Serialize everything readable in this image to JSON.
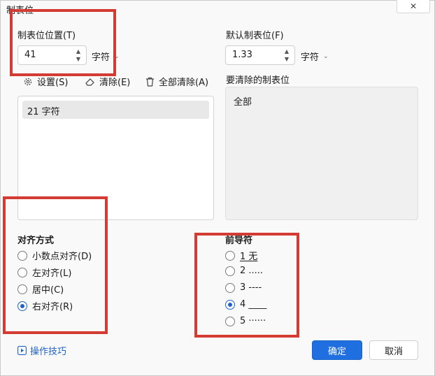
{
  "window": {
    "title": "制表位",
    "close_glyph": "✕"
  },
  "tab_position": {
    "label": "制表位位置(T)",
    "value": "41",
    "unit": "字符"
  },
  "default_tab": {
    "label": "默认制表位(F)",
    "value": "1.33",
    "unit": "字符"
  },
  "tabs_to_clear": {
    "label": "要清除的制表位",
    "value": "全部"
  },
  "toolbar": {
    "set_label": "设置(S)",
    "clear_label": "清除(E)",
    "clear_all_label": "全部清除(A)"
  },
  "tab_list": {
    "items": [
      "21 字符"
    ]
  },
  "alignment": {
    "title": "对齐方式",
    "options": [
      "小数点对齐(D)",
      "左对齐(L)",
      "居中(C)",
      "右对齐(R)"
    ],
    "selected_index": 3
  },
  "leader": {
    "title": "前导符",
    "options": [
      "1 无",
      "2 .....",
      "3 ----",
      "4 ____",
      "5  ······"
    ],
    "selected_index": 3
  },
  "footer": {
    "tips_label": "操作技巧",
    "ok_label": "确定",
    "cancel_label": "取消"
  },
  "colors": {
    "accent": "#1f6fe0",
    "highlight_box": "#d33b33"
  }
}
